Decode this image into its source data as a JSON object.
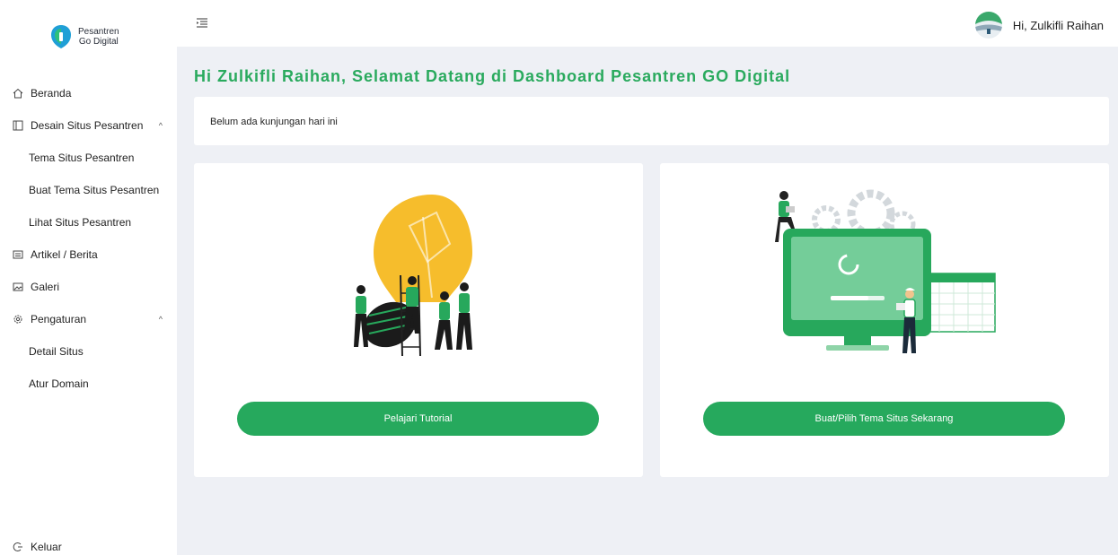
{
  "brand": {
    "line1": "Pesantren",
    "line2": "Go Digital"
  },
  "sidebar": {
    "items": [
      {
        "label": "Beranda",
        "icon": "home-icon"
      },
      {
        "label": "Desain Situs Pesantren",
        "icon": "layout-icon",
        "chevron": "^"
      },
      {
        "label": "Tema Situs Pesantren"
      },
      {
        "label": "Buat Tema Situs Pesantren"
      },
      {
        "label": "Lihat Situs Pesantren"
      },
      {
        "label": "Artikel / Berita",
        "icon": "newspaper-icon"
      },
      {
        "label": "Galeri",
        "icon": "image-icon"
      },
      {
        "label": "Pengaturan",
        "icon": "gear-icon",
        "chevron": "^"
      },
      {
        "label": "Detail Situs"
      },
      {
        "label": "Atur Domain"
      }
    ],
    "logout": "Keluar"
  },
  "header": {
    "greeting": "Hi, Zulkifli Raihan"
  },
  "main": {
    "title": "Hi Zulkifli Raihan, Selamat Datang di Dashboard Pesantren GO Digital",
    "notice": "Belum ada kunjungan hari ini",
    "cards": [
      {
        "button": "Pelajari Tutorial"
      },
      {
        "button": "Buat/Pilih Tema Situs Sekarang"
      }
    ]
  },
  "colors": {
    "accent": "#26a95d",
    "background": "#eef0f5",
    "bulb": "#f6bd2c"
  }
}
